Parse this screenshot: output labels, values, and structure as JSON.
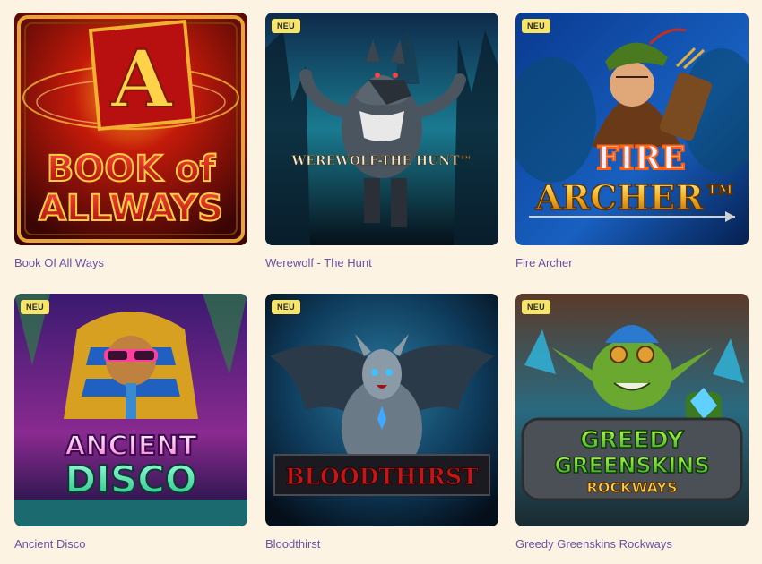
{
  "games": [
    {
      "title": "Book Of All Ways",
      "badge": "",
      "logo_lines": [
        "BOOK of",
        "ALLWAYS"
      ],
      "logo_letter": "A"
    },
    {
      "title": "Werewolf - The Hunt",
      "badge": "NEU",
      "logo_lines": [
        "WEREWOLF-THE HUNT™"
      ]
    },
    {
      "title": "Fire Archer",
      "badge": "NEU",
      "logo_lines": [
        "FIRE",
        "ARCHER™"
      ]
    },
    {
      "title": "Ancient Disco",
      "badge": "NEU",
      "logo_lines": [
        "ANCIENT",
        "DISCO"
      ]
    },
    {
      "title": "Bloodthirst",
      "badge": "NEU",
      "logo_lines": [
        "BLOODTHIRST"
      ]
    },
    {
      "title": "Greedy Greenskins Rockways",
      "badge": "NEU",
      "logo_lines": [
        "GREEDY",
        "GREENSKINS",
        "ROCKWAYS"
      ]
    }
  ]
}
